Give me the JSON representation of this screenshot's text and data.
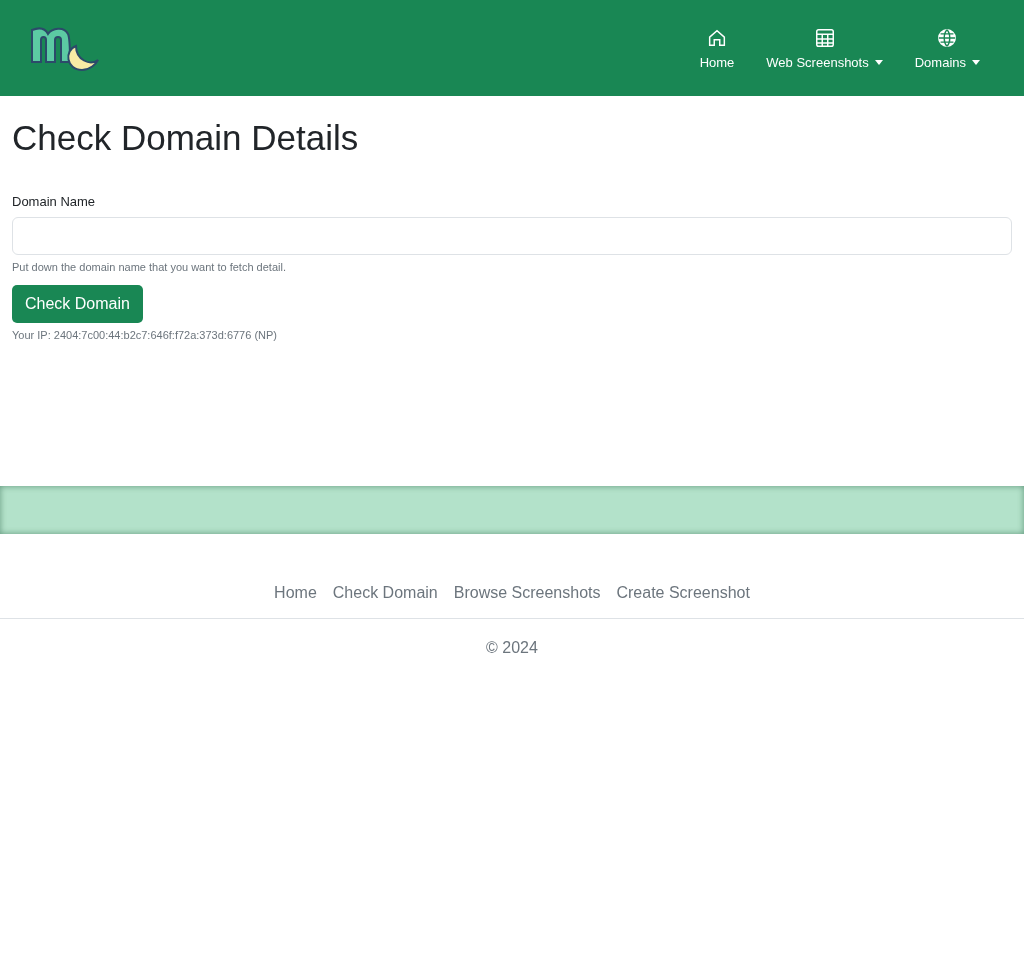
{
  "navbar": {
    "items": [
      {
        "label": "Home",
        "kind": "home",
        "dropdown": false
      },
      {
        "label": "Web Screenshots",
        "kind": "table",
        "dropdown": true
      },
      {
        "label": "Domains",
        "kind": "globe",
        "dropdown": true
      }
    ]
  },
  "page": {
    "title": "Check Domain Details",
    "field": {
      "label": "Domain Name",
      "help": "Put down the domain name that you want to fetch detail."
    },
    "button": "Check Domain",
    "ip": "Your IP: 2404:7c00:44:b2c7:646f:f72a:373d:6776 (NP)"
  },
  "footer": {
    "links": [
      "Home",
      "Check Domain",
      "Browse Screenshots",
      "Create Screenshot"
    ],
    "copyright": "© 2024"
  }
}
